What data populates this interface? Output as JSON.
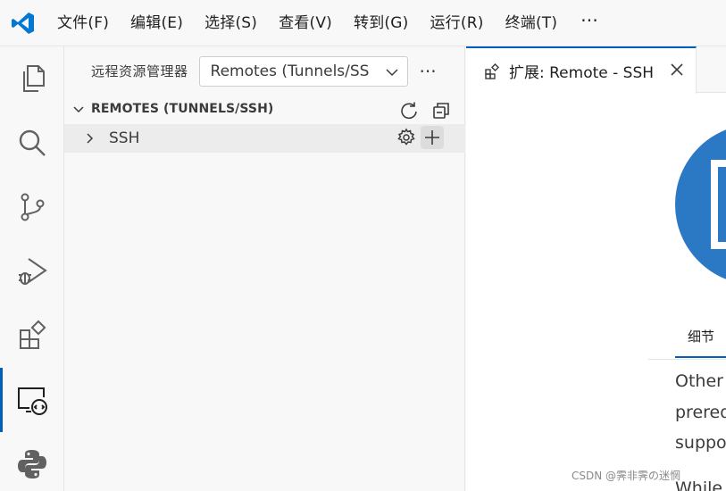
{
  "menu": {
    "items": [
      "文件(F)",
      "编辑(E)",
      "选择(S)",
      "查看(V)",
      "转到(G)",
      "运行(R)",
      "终端(T)"
    ],
    "more": "···"
  },
  "activity_bar": {
    "items": [
      {
        "name": "explorer-icon",
        "active": false
      },
      {
        "name": "search-icon",
        "active": false
      },
      {
        "name": "source-control-icon",
        "active": false
      },
      {
        "name": "run-debug-icon",
        "active": false
      },
      {
        "name": "extensions-icon",
        "active": false
      },
      {
        "name": "remote-explorer-icon",
        "active": true
      },
      {
        "name": "python-icon",
        "active": false
      }
    ],
    "accent": "#005fb8"
  },
  "sidebar": {
    "title": "远程资源管理器",
    "select_value": "Remotes (Tunnels/SS",
    "more": "···",
    "section_title": "REMOTES (TUNNELS/SSH)",
    "tree_item": "SSH"
  },
  "editor": {
    "tab_label": "扩展: Remote - SSH",
    "detail_tab": "细节",
    "desc_lines": [
      "Other |",
      "prereq",
      "suppor",
      "While"
    ],
    "logo_color": "#2b78c4"
  },
  "watermark": "CSDN @霁非霁の迷惘"
}
